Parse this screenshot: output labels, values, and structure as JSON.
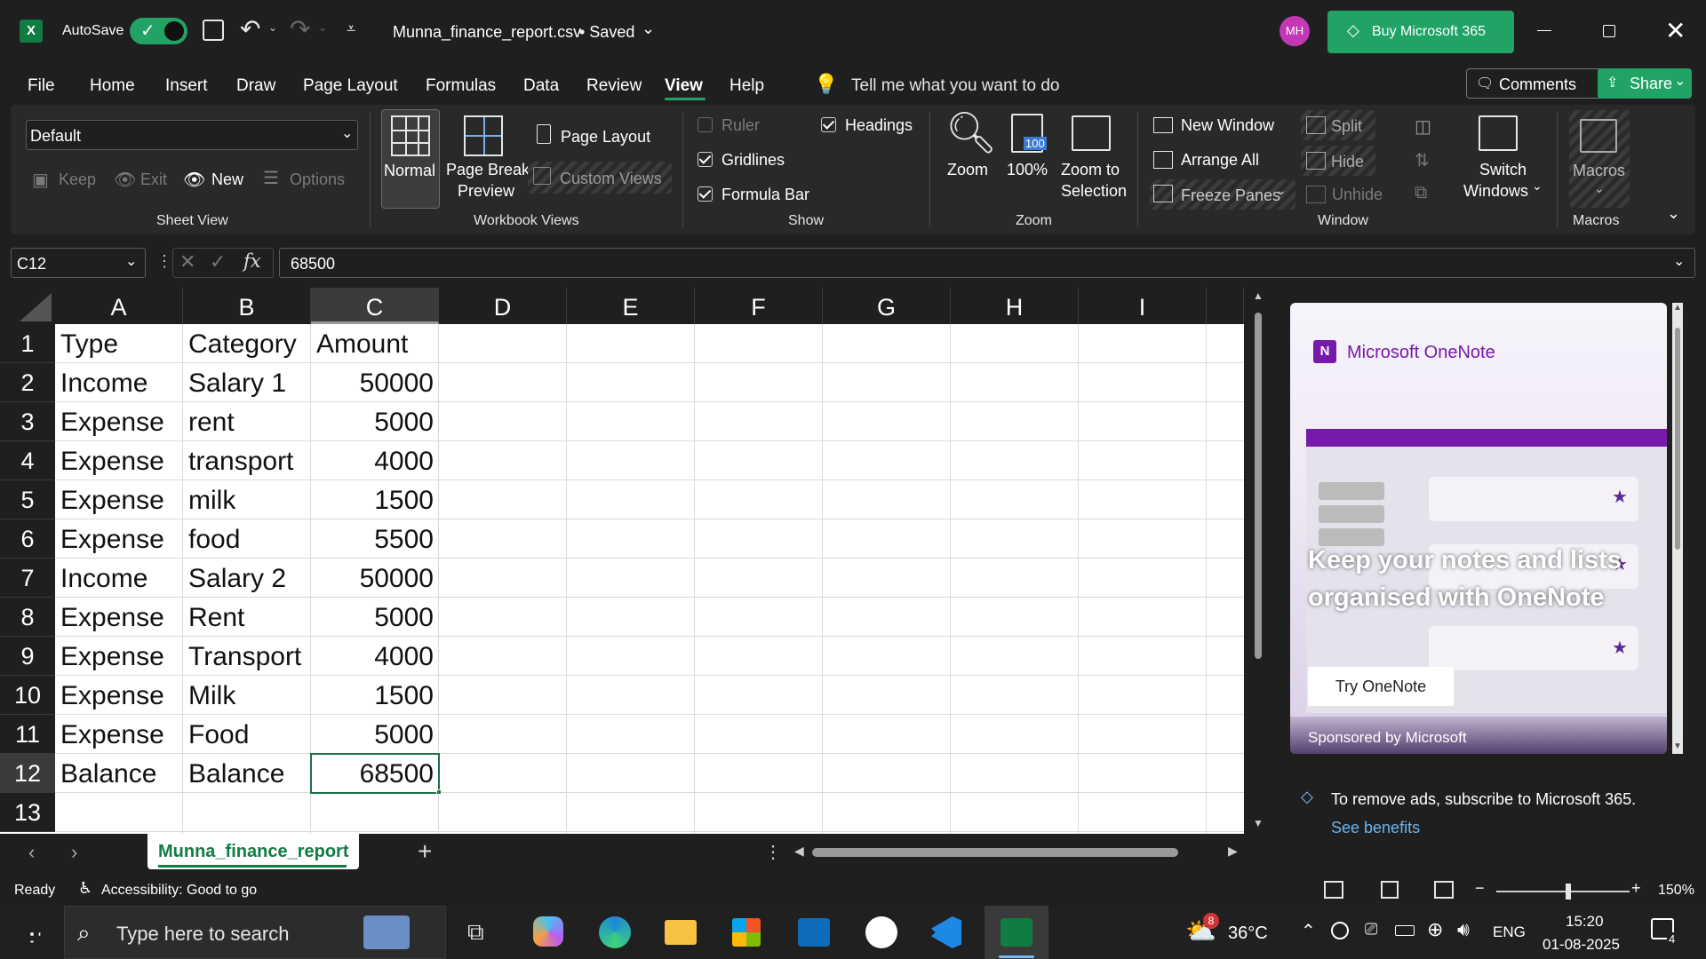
{
  "title_bar": {
    "autosave_label": "AutoSave",
    "file_title": "Munna_finance_report.csv",
    "save_state": "• Saved",
    "avatar_initials": "MH",
    "buy_label": "Buy Microsoft 365"
  },
  "menu": {
    "items": [
      "File",
      "Home",
      "Insert",
      "Draw",
      "Page Layout",
      "Formulas",
      "Data",
      "Review",
      "View",
      "Help"
    ],
    "active": "View",
    "tell_me": "Tell me what you want to do",
    "comments_label": "Comments",
    "share_label": "Share"
  },
  "ribbon": {
    "sheet_view": {
      "dropdown_value": "Default",
      "keep": "Keep",
      "exit": "Exit",
      "new": "New",
      "options": "Options",
      "group_label": "Sheet View"
    },
    "workbook_views": {
      "normal": "Normal",
      "page_break_1": "Page Break",
      "page_break_2": "Preview",
      "page_layout": "Page Layout",
      "custom_views": "Custom Views",
      "group_label": "Workbook Views"
    },
    "show": {
      "ruler": "Ruler",
      "gridlines": "Gridlines",
      "formula_bar": "Formula Bar",
      "headings": "Headings",
      "group_label": "Show"
    },
    "zoom": {
      "zoom": "Zoom",
      "hundred": "100%",
      "hundred_badge": "100",
      "zoom_sel_1": "Zoom to",
      "zoom_sel_2": "Selection",
      "group_label": "Zoom"
    },
    "window": {
      "new_window": "New Window",
      "arrange_all": "Arrange All",
      "freeze_panes": "Freeze Panes",
      "split": "Split",
      "hide": "Hide",
      "unhide": "Unhide",
      "switch_1": "Switch",
      "switch_2": "Windows",
      "group_label": "Window"
    },
    "macros": {
      "macros": "Macros",
      "group_label": "Macros"
    }
  },
  "formula_bar": {
    "name_box": "C12",
    "fx": "fx",
    "value": "68500"
  },
  "sheet": {
    "columns": [
      "A",
      "B",
      "C",
      "D",
      "E",
      "F",
      "G",
      "H",
      "I"
    ],
    "selected_column": "C",
    "row_numbers": [
      "1",
      "2",
      "3",
      "4",
      "5",
      "6",
      "7",
      "8",
      "9",
      "10",
      "11",
      "12",
      "13"
    ],
    "selected_row": "12",
    "rows": [
      [
        "Type",
        "Category",
        "Amount"
      ],
      [
        "Income",
        "Salary 1",
        "50000"
      ],
      [
        "Expense",
        "rent",
        "5000"
      ],
      [
        "Expense",
        "transport",
        "4000"
      ],
      [
        "Expense",
        "milk",
        "1500"
      ],
      [
        "Expense",
        "food",
        "5500"
      ],
      [
        "Income",
        "Salary 2",
        "50000"
      ],
      [
        "Expense",
        "Rent",
        "5000"
      ],
      [
        "Expense",
        "Transport",
        "4000"
      ],
      [
        "Expense",
        "Milk",
        "1500"
      ],
      [
        "Expense",
        "Food",
        "5000"
      ],
      [
        "Balance",
        "Balance",
        "68500"
      ]
    ]
  },
  "sheet_tabs": {
    "active_tab": "Munna_finance_report",
    "add": "+"
  },
  "ad_panel": {
    "brand": "Microsoft OneNote",
    "headline_1": "Keep your notes and lists",
    "headline_2": "organised with OneNote",
    "cta": "Try OneNote",
    "sponsored": "Sponsored by Microsoft",
    "remove_ads": "To remove ads, subscribe to Microsoft 365.",
    "see_benefits": "See benefits"
  },
  "status_bar": {
    "ready": "Ready",
    "accessibility": "Accessibility: Good to go",
    "zoom": "150%"
  },
  "taskbar": {
    "search_placeholder": "Type here to search",
    "weather_badge": "8",
    "temperature": "36°C",
    "language": "ENG",
    "time": "15:20",
    "date": "01-08-2025",
    "notifications": "4"
  },
  "colors": {
    "excel_green": "#107c41",
    "accent_buy": "#21a366",
    "selection": "#1e7145",
    "avatar": "#c239b3",
    "onenote_purple": "#7719aa"
  }
}
